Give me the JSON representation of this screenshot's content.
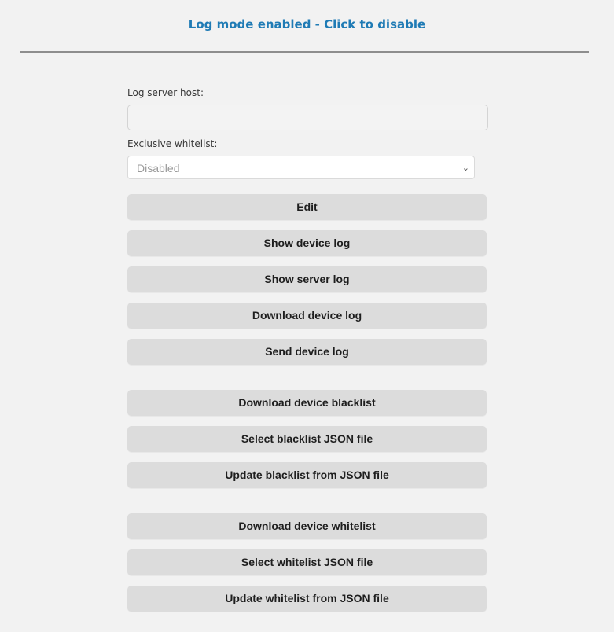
{
  "header": {
    "toggle_label": "Log mode enabled - Click to disable",
    "accent_color": "#1f7bb5"
  },
  "form": {
    "log_server_host": {
      "label": "Log server host:",
      "value": "",
      "placeholder": ""
    },
    "exclusive_whitelist": {
      "label": "Exclusive whitelist:",
      "selected": "Disabled"
    }
  },
  "buttons": {
    "log_group": [
      "Edit",
      "Show device log",
      "Show server log",
      "Download device log",
      "Send device log"
    ],
    "blacklist_group": [
      "Download device blacklist",
      "Select blacklist JSON file",
      "Update blacklist from JSON file"
    ],
    "whitelist_group": [
      "Download device whitelist",
      "Select whitelist JSON file",
      "Update whitelist from JSON file"
    ]
  }
}
